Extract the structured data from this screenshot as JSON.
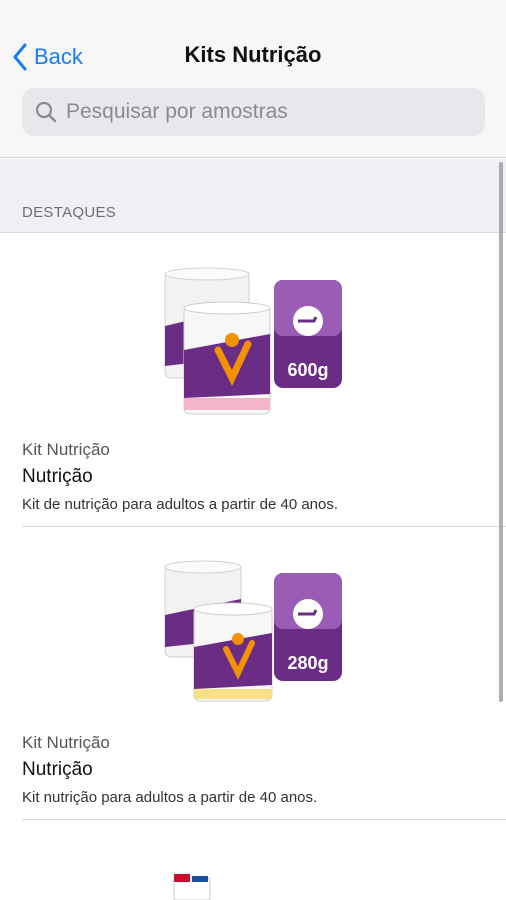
{
  "header": {
    "back_label": "Back",
    "title": "Kits Nutrição"
  },
  "search": {
    "placeholder": "Pesquisar por amostras"
  },
  "section": {
    "title": "DESTAQUES"
  },
  "items": [
    {
      "category": "Kit Nutrição",
      "name": "Nutrição",
      "description": "Kit de nutrição para adultos a partir de 40 anos.",
      "badge": "600g",
      "label_color": "#f3b5cc"
    },
    {
      "category": "Kit Nutrição",
      "name": "Nutrição",
      "description": "Kit nutrição para adultos a partir de 40 anos.",
      "badge": "280g",
      "label_color": "#f6e08a"
    }
  ],
  "colors": {
    "accent": "#1a7cf5",
    "brand_purple": "#6b2c86",
    "brand_orange": "#f39200"
  }
}
